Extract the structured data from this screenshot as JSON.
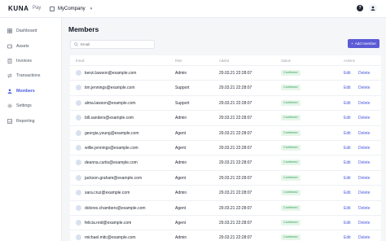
{
  "header": {
    "logo": "KUNA",
    "product": "Pay",
    "company": "MyCompany",
    "help_glyph": "?"
  },
  "sidebar": {
    "items": [
      {
        "label": "Dashboard",
        "icon": "dashboard-icon"
      },
      {
        "label": "Assets",
        "icon": "wallet-icon"
      },
      {
        "label": "Invoices",
        "icon": "invoice-icon"
      },
      {
        "label": "Transactions",
        "icon": "transactions-icon"
      },
      {
        "label": "Members",
        "icon": "members-icon",
        "active": true
      },
      {
        "label": "Settings",
        "icon": "gear-icon"
      },
      {
        "label": "Reporting",
        "icon": "report-icon"
      }
    ]
  },
  "main": {
    "title": "Members",
    "search_placeholder": "Email",
    "add_button": "Add member",
    "columns": [
      "Email",
      "Role",
      "Added",
      "Status",
      "Actions"
    ],
    "rows": [
      {
        "email": "kenzi.lawson@example.com",
        "role": "Admin",
        "added": "29.03.21 22:28:07",
        "status": "Confirmed"
      },
      {
        "email": "tim.jennings@example.com",
        "role": "Support",
        "added": "29.03.21 22:28:07",
        "status": "Confirmed"
      },
      {
        "email": "alma.lawson@example.com",
        "role": "Support",
        "added": "29.03.21 22:28:07",
        "status": "Confirmed"
      },
      {
        "email": "bill.sanders@example.com",
        "role": "Admin",
        "added": "29.03.21 22:28:07",
        "status": "Confirmed"
      },
      {
        "email": "georgia.young@example.com",
        "role": "Agent",
        "added": "29.03.21 22:28:07",
        "status": "Confirmed"
      },
      {
        "email": "willie.jennings@example.com",
        "role": "Agent",
        "added": "29.03.21 22:28:07",
        "status": "Confirmed"
      },
      {
        "email": "deanna.curtis@example.com",
        "role": "Admin",
        "added": "29.03.21 22:28:07",
        "status": "Confirmed"
      },
      {
        "email": "jackson.graham@example.com",
        "role": "Agent",
        "added": "29.03.21 22:28:07",
        "status": "Confirmed"
      },
      {
        "email": "sara.cruz@example.com",
        "role": "Admin",
        "added": "29.03.21 22:28:07",
        "status": "Confirmed"
      },
      {
        "email": "dolores.chambers@example.com",
        "role": "Agent",
        "added": "29.03.21 22:28:07",
        "status": "Confirmed"
      },
      {
        "email": "felicia.reid@example.com",
        "role": "Agent",
        "added": "29.03.21 22:28:07",
        "status": "Confirmed"
      },
      {
        "email": "michael.mitc@example.com",
        "role": "Admin",
        "added": "29.03.21 22:28:07",
        "status": "Confirmed"
      }
    ],
    "edit_label": "Edit",
    "delete_label": "Delete"
  },
  "colors": {
    "accent": "#5b5bd6",
    "link": "#4a5be0",
    "status_bg": "#e6f6ea",
    "status_text": "#2f9d55"
  }
}
